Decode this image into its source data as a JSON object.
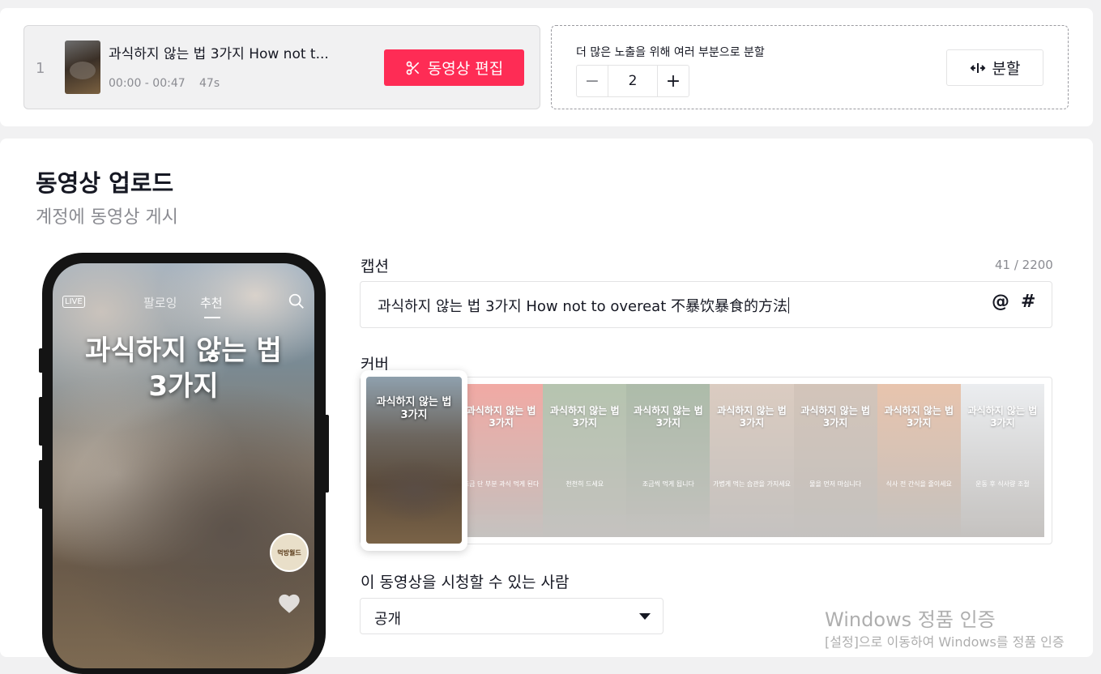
{
  "split_bar": {
    "video": {
      "index": "1",
      "title": "과식하지 않는 법 3가지 How not t...",
      "time_range": "00:00 - 00:47",
      "duration": "47s"
    },
    "edit_button_label": "동영상 편집",
    "split_label": "더 많은 노출을 위해 여러 부분으로 분할",
    "stepper": {
      "minus": "−",
      "value": "2",
      "plus": "+"
    },
    "split_button_label": "분할"
  },
  "upload": {
    "title": "동영상 업로드",
    "subtitle": "계정에 동영상 게시"
  },
  "phone_preview": {
    "live_badge": "LIVE",
    "tabs": [
      "팔로잉",
      "추천"
    ],
    "active_tab": "추천",
    "caption_line1": "과식하지 않는 법",
    "caption_line2": "3가지",
    "avatar_text": "먹방월드"
  },
  "caption": {
    "label": "캡션",
    "count": "41 / 2200",
    "value": "과식하지 않는 법 3가지 How not to overeat 不暴饮暴食的方法",
    "mention_symbol": "@",
    "hashtag_symbol": "#"
  },
  "cover": {
    "label": "커버",
    "selected_text": "과식하지 않는 법\n3가지",
    "frames": [
      {
        "text": "과식하지 않는 법\n3가지",
        "sub": "조금 단 부분 과식 먹게 된다",
        "color": "#e5564b"
      },
      {
        "text": "과식하지 않는 법\n3가지",
        "sub": "천천히 드세요",
        "color": "#6f8a62"
      },
      {
        "text": "과식하지 않는 법\n3가지",
        "sub": "조금씩 먹게 됩니다",
        "color": "#5d7a56"
      },
      {
        "text": "과식하지 않는 법\n3가지",
        "sub": "가볍게 먹는 습관을 가지세요",
        "color": "#b89a84"
      },
      {
        "text": "과식하지 않는 법\n3가지",
        "sub": "물을 먼저 마십니다",
        "color": "#a88b76"
      },
      {
        "text": "과식하지 않는 법\n3가지",
        "sub": "식사 전 간식을 줄이세요",
        "color": "#d28a5e"
      },
      {
        "text": "과식하지 않는 법\n3가지",
        "sub": "운동 후 식사량 조절",
        "color": "#d9dde2"
      }
    ]
  },
  "visibility": {
    "label": "이 동영상을 시청할 수 있는 사람",
    "value": "공개"
  },
  "watermark": {
    "line1": "Windows 정품 인증",
    "line2": "[설정]으로 이동하여 Windows를 정품 인증"
  },
  "colors": {
    "accent": "#fe2c55",
    "text_primary": "#161823",
    "text_secondary": "#8a8b91"
  }
}
